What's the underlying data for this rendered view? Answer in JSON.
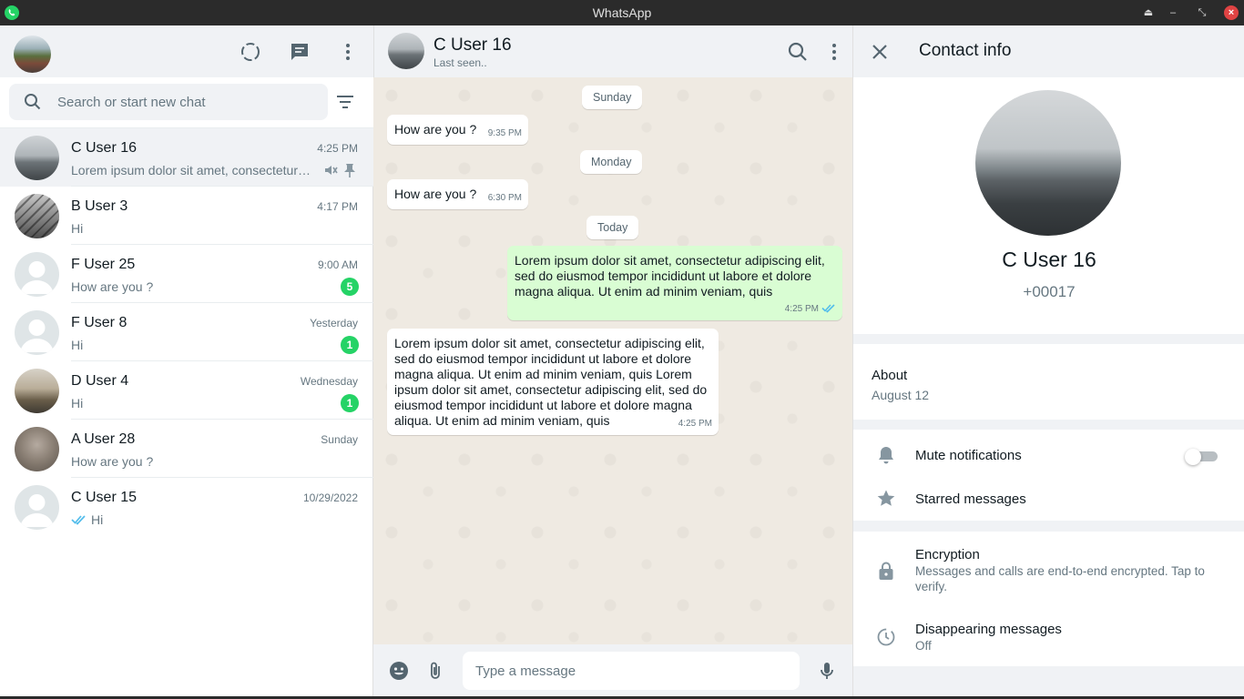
{
  "window": {
    "title": "WhatsApp"
  },
  "search": {
    "placeholder": "Search or start new chat"
  },
  "chats": [
    {
      "name": "C User 16",
      "time": "4:25 PM",
      "preview": "Lorem ipsum dolor sit amet, consectetur adipiscing elit",
      "muted": true,
      "pinned": true
    },
    {
      "name": "B User 3",
      "time": "4:17 PM",
      "preview": "Hi"
    },
    {
      "name": "F User 25",
      "time": "9:00 AM",
      "preview": "How are you ?",
      "unread": "5"
    },
    {
      "name": "F User 8",
      "time": "Yesterday",
      "preview": "Hi",
      "unread": "1"
    },
    {
      "name": "D User 4",
      "time": "Wednesday",
      "preview": "Hi",
      "unread": "1"
    },
    {
      "name": "A User 28",
      "time": "Sunday",
      "preview": "How are you ?"
    },
    {
      "name": "C User 15",
      "time": "10/29/2022",
      "preview": "Hi",
      "sent_read": true
    }
  ],
  "conversation": {
    "name": "C User 16",
    "status": "Last seen..",
    "day_labels": [
      "Sunday",
      "Monday",
      "Today"
    ],
    "messages": [
      {
        "text": "How are you ?",
        "time": "9:35 PM",
        "direction": "in"
      },
      {
        "text": "How are you ?",
        "time": "6:30 PM",
        "direction": "in"
      },
      {
        "text": "Lorem ipsum dolor sit amet, consectetur adipiscing elit, sed do eiusmod tempor incididunt ut labore et dolore magna aliqua. Ut enim ad minim veniam, quis",
        "time": "4:25 PM",
        "direction": "out",
        "read": true
      },
      {
        "text": "Lorem ipsum dolor sit amet, consectetur adipiscing elit, sed do eiusmod tempor incididunt ut labore et dolore magna aliqua. Ut enim ad minim veniam, quis Lorem ipsum dolor sit amet, consectetur adipiscing elit, sed do eiusmod tempor incididunt ut labore et dolore magna aliqua. Ut enim ad minim veniam, quis",
        "time": "4:25 PM",
        "direction": "in"
      }
    ]
  },
  "composer": {
    "placeholder": "Type a message"
  },
  "contact_info": {
    "title": "Contact info",
    "name": "C User 16",
    "phone": "+00017",
    "about_label": "About",
    "about_value": "August 12",
    "mute_label": "Mute notifications",
    "mute_enabled": false,
    "starred_label": "Starred messages",
    "encryption_label": "Encryption",
    "encryption_text": "Messages and calls are end-to-end encrypted. Tap to verify.",
    "disappearing_label": "Disappearing messages",
    "disappearing_value": "Off"
  },
  "icons": {
    "app": "whatsapp-logo-icon",
    "status": "status-icon",
    "new_chat": "new-chat-icon",
    "menu": "menu-icon",
    "search": "search-icon",
    "filter": "filter-icon",
    "mute": "mute-icon",
    "pin": "pin-icon",
    "read": "double-check-icon",
    "close": "close-icon",
    "emoji": "emoji-icon",
    "attach": "attach-icon",
    "mic": "mic-icon",
    "bell": "bell-icon",
    "star": "star-icon",
    "lock": "lock-icon",
    "timer": "timer-icon"
  },
  "colors": {
    "accent": "#25d366",
    "outgoing_bubble": "#d9fdd3",
    "read_ticks": "#53bdeb",
    "chat_background": "#efeae2"
  }
}
